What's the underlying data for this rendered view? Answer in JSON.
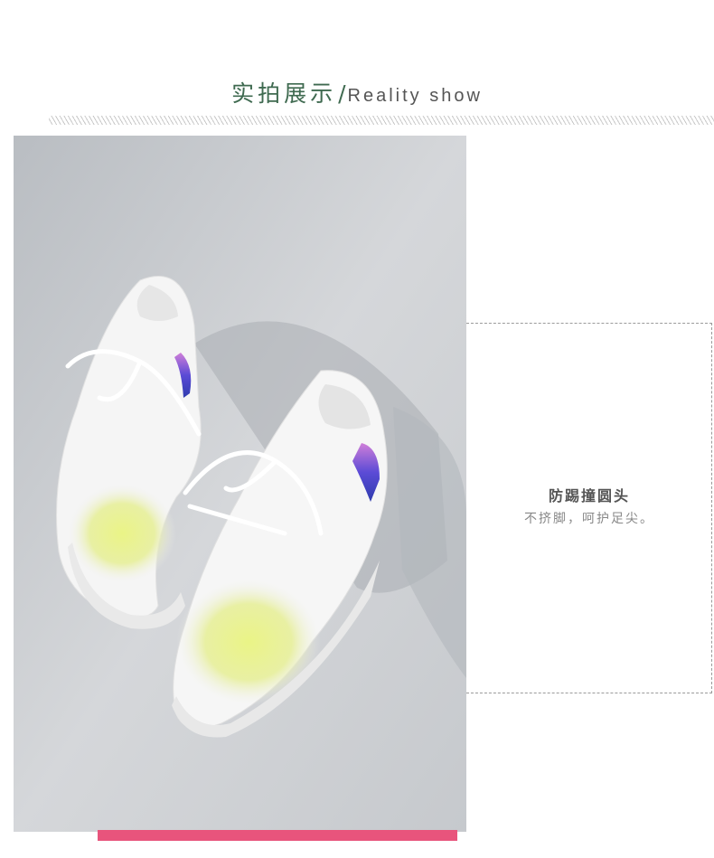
{
  "header": {
    "title_cn": "实拍展示",
    "separator": "/",
    "title_en": "Reality show"
  },
  "photo": {
    "subject": "sneaker-photo",
    "accent_colors": {
      "background": "#d0d3d7",
      "shoe": "#f7f7f7",
      "mesh_yellow": "#e3f07a",
      "stripe_purple": "#6a4fd8"
    }
  },
  "feature": {
    "title": "防踢撞圆头",
    "description": "不挤脚，呵护足尖。"
  },
  "colors": {
    "title_green": "#3f6a50",
    "accent_pink": "#e8547c",
    "dashed_border": "#9a9a9a"
  }
}
